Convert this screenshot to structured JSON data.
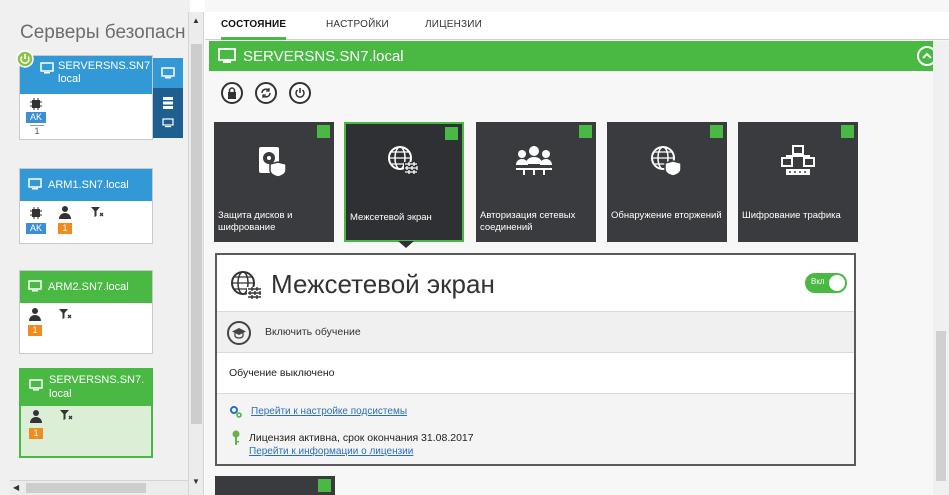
{
  "sidebar": {
    "title": "Серверы безопасн",
    "cards": [
      {
        "name_line1": "SERVERSNS.SN7",
        "name_line2": "local",
        "badge_ak": "AK",
        "badge_num": "1"
      },
      {
        "name": "ARM1.SN7.local",
        "badge_ak": "AK",
        "badge_num": "1"
      },
      {
        "name": "ARM2.SN7.local",
        "badge_num": "1"
      },
      {
        "name_line1": "SERVERSNS.SN7.",
        "name_line2": "local",
        "badge_num": "1"
      }
    ]
  },
  "tabs": [
    {
      "label": "СОСТОЯНИЕ",
      "active": true
    },
    {
      "label": "НАСТРОЙКИ",
      "active": false
    },
    {
      "label": "ЛИЦЕНЗИИ",
      "active": false
    }
  ],
  "server": {
    "title": "SERVERSNS.SN7.local"
  },
  "actions": [
    "lock-icon",
    "sync-icon",
    "power-icon"
  ],
  "tiles": [
    {
      "label": "Защита дисков и шифрование",
      "icon": "disk-shield-icon"
    },
    {
      "label": "Межсетевой экран",
      "icon": "firewall-globe-icon"
    },
    {
      "label": "Авторизация сетевых соединений",
      "icon": "network-users-icon"
    },
    {
      "label": "Обнаружение вторжений",
      "icon": "globe-shield-icon"
    },
    {
      "label": "Шифрование трафика",
      "icon": "network-encryption-icon"
    }
  ],
  "detail": {
    "title": "Межсетевой экран",
    "toggle_label": "Вкл",
    "learning_label": "Включить обучение",
    "learning_status": "Обучение выключено",
    "settings_link": "Перейти к настройке подсистемы",
    "license_text": "Лицензия активна, срок окончания 31.08.2017",
    "license_link": "Перейти к информации о лицензии"
  },
  "colors": {
    "accent_green": "#49b944",
    "accent_blue": "#3399d6",
    "tile_dark": "#3a3b3e",
    "badge_orange": "#f08c1e"
  }
}
